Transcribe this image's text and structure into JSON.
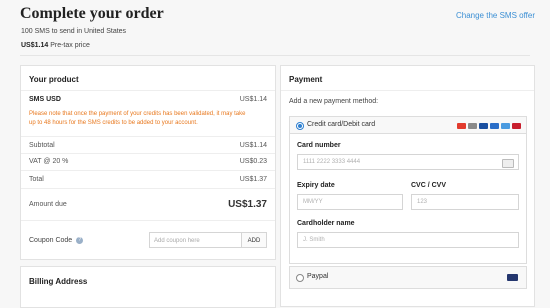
{
  "header": {
    "title": "Complete your order",
    "change_link": "Change the SMS offer",
    "line1": "100 SMS to send in United States",
    "price_value": "US$1.14",
    "price_suffix": "Pre-tax price"
  },
  "product": {
    "heading": "Your product",
    "item_name": "SMS USD",
    "item_price": "US$1.14",
    "note": "Please note that once the payment of your credits has been validated, it may take up to 48 hours for the SMS credits to be added to your account.",
    "subtotal_label": "Subtotal",
    "subtotal_value": "US$1.14",
    "vat_label": "VAT @ 20 %",
    "vat_value": "US$0.23",
    "total_label": "Total",
    "total_value": "US$1.37",
    "amount_label": "Amount due",
    "amount_value": "US$1.37",
    "coupon_label": "Coupon Code",
    "coupon_placeholder": "Add coupon here",
    "coupon_button": "ADD"
  },
  "billing": {
    "heading": "Billing Address"
  },
  "payment": {
    "heading": "Payment",
    "sublabel": "Add a new payment method:",
    "cc_label": "Credit card/Debit card",
    "card_brand_colors": [
      "#e23b2e",
      "#8a8a8a",
      "#1a4fa0",
      "#2a6ec8",
      "#4a9be0",
      "#c81e2d"
    ],
    "card_number_label": "Card number",
    "card_number_placeholder": "1111 2222 3333 4444",
    "expiry_label": "Expiry date",
    "expiry_placeholder": "MM/YY",
    "cvc_label": "CVC / CVV",
    "cvc_placeholder": "123",
    "holder_label": "Cardholder name",
    "holder_placeholder": "J. Smith",
    "paypal_label": "Paypal"
  }
}
